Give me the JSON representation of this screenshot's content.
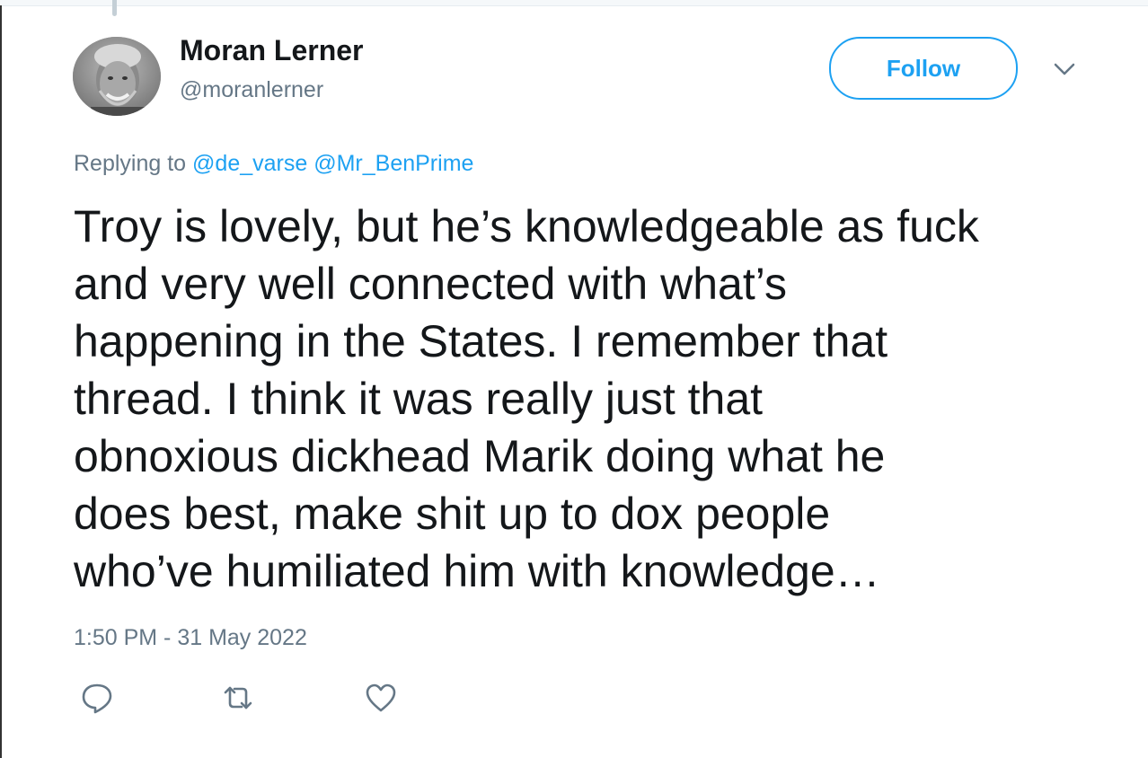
{
  "tweet": {
    "author": {
      "display_name": "Moran Lerner",
      "handle": "@moranlerner",
      "avatar_icon": "person-photo-avatar"
    },
    "follow_label": "Follow",
    "replying": {
      "prefix": "Replying to",
      "mentions": [
        "@de_varse",
        "@Mr_BenPrime"
      ]
    },
    "text_lines": [
      "Troy is lovely, but he’s knowledgeable as fuck",
      "and very well connected with what’s",
      "happening in the States. I remember that",
      "thread. I think it was really just that",
      "obnoxious dickhead Marik doing what he",
      "does best, make shit up to dox people",
      "who’ve humiliated him with knowledge…"
    ],
    "timestamp": "1:50 PM - 31 May 2022",
    "actions": [
      {
        "name": "reply",
        "icon": "reply-icon"
      },
      {
        "name": "retweet",
        "icon": "retweet-icon"
      },
      {
        "name": "like",
        "icon": "heart-icon"
      }
    ]
  },
  "colors": {
    "accent": "#1da1f2",
    "text": "#14171a",
    "muted": "#657786"
  }
}
